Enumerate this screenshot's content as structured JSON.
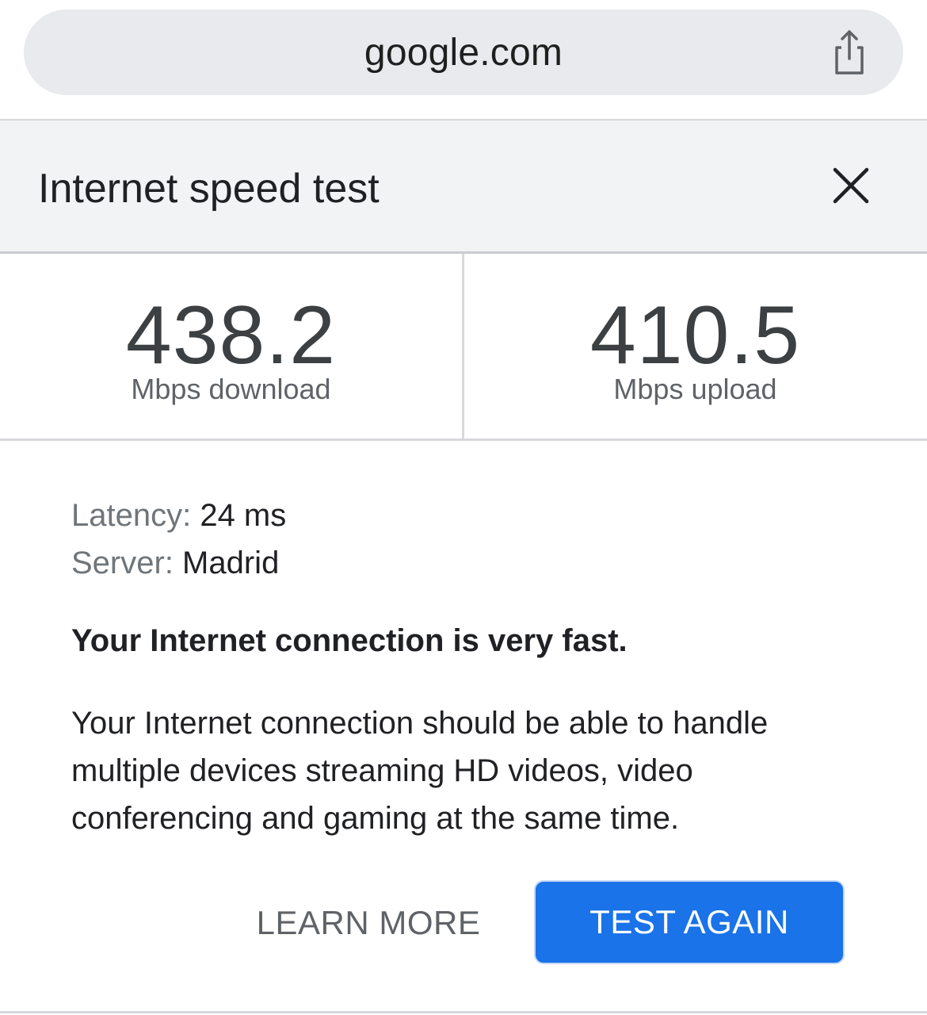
{
  "browser": {
    "url": "google.com",
    "share_icon": "share-icon"
  },
  "card": {
    "title": "Internet speed test",
    "close_icon": "close-icon"
  },
  "results": {
    "download": {
      "value": "438.2",
      "label": "Mbps download"
    },
    "upload": {
      "value": "410.5",
      "label": "Mbps upload"
    }
  },
  "details": {
    "latency_key": "Latency:",
    "latency_value": "24 ms",
    "server_key": "Server:",
    "server_value": "Madrid"
  },
  "verdict": "Your Internet connection is very fast.",
  "description": "Your Internet connection should be able to handle multiple devices streaming HD videos, video conferencing and gaming at the same time.",
  "actions": {
    "learn_more": "LEARN MORE",
    "test_again": "TEST AGAIN"
  },
  "colors": {
    "accent": "#1a73e8",
    "header_bg": "#f1f3f4",
    "url_bar_bg": "#e8eaed"
  }
}
